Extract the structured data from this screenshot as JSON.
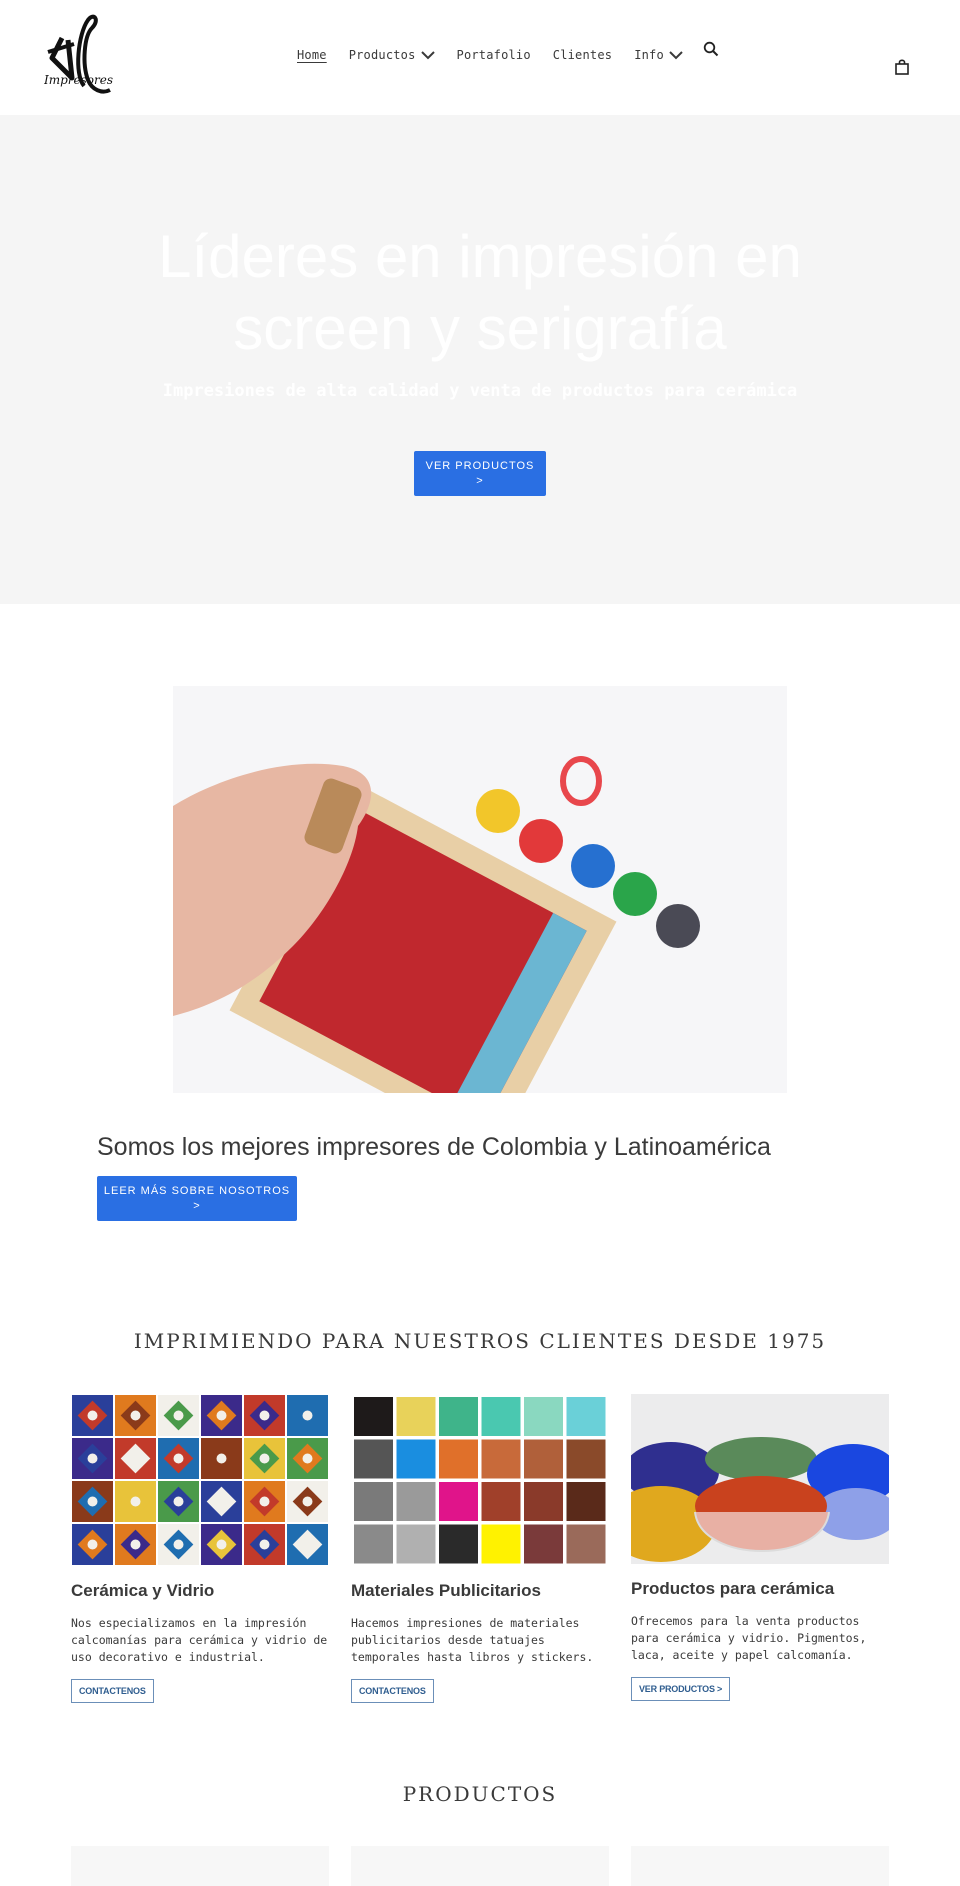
{
  "header": {
    "logo_alt": "TL Impresores",
    "logo_script_text": "Impresores",
    "nav": [
      {
        "label": "Home",
        "active": true,
        "has_dropdown": false
      },
      {
        "label": "Productos",
        "active": false,
        "has_dropdown": true
      },
      {
        "label": "Portafolio",
        "active": false,
        "has_dropdown": false
      },
      {
        "label": "Clientes",
        "active": false,
        "has_dropdown": false
      },
      {
        "label": "Info",
        "active": false,
        "has_dropdown": true
      }
    ],
    "icons": {
      "search": "search-icon",
      "cart": "shopping-bag-icon",
      "dropdown": "chevron-down-icon"
    }
  },
  "hero": {
    "title": "Líderes en impresión en screen y serigrafía",
    "subtitle": "Impresiones de alta calidad y venta de productos para cerámica",
    "button_line1": "VER PRODUCTOS",
    "button_line2": ">"
  },
  "feature": {
    "image_alt": "Mano usando una raqueta de serigrafía con pintura roja y frascos de colores",
    "title": "Somos los mejores impresores de Colombia y Latinoamérica",
    "button_line1": "LEER MÁS SOBRE NOSOTROS",
    "button_line2": ">"
  },
  "services": {
    "heading": "IMPRIMIENDO PARA NUESTROS CLIENTES DESDE 1975",
    "cards": [
      {
        "title": "Cerámica y Vidrio",
        "text": "Nos especializamos en la impresión calcomanías para cerámica y vidrio de uso decorativo e industrial.",
        "button": "CONTACTENOS",
        "image_alt": "Azulejos decorativos de colores"
      },
      {
        "title": "Materiales Publicitarios",
        "text": "Hacemos impresiones de materiales publicitarios desde tatuajes temporales hasta libros y stickers.",
        "button": "CONTACTENOS",
        "image_alt": "Cuadrícula de colores CMYK y muestrarios"
      },
      {
        "title": "Productos para cerámica",
        "text": "Ofrecemos para la venta productos para cerámica y vidrio. Pigmentos, laca, aceite y papel calcomanía.",
        "button": "VER PRODUCTOS >",
        "image_alt": "Pigmentos en polvo de colores en tazones"
      }
    ]
  },
  "products": {
    "heading": "PRODUCTOS"
  },
  "colors": {
    "accent": "#2a6fe3",
    "hero_bg": "#f5f5f5",
    "text": "#3a3a3a",
    "outline_button": "#2f5d8f"
  }
}
